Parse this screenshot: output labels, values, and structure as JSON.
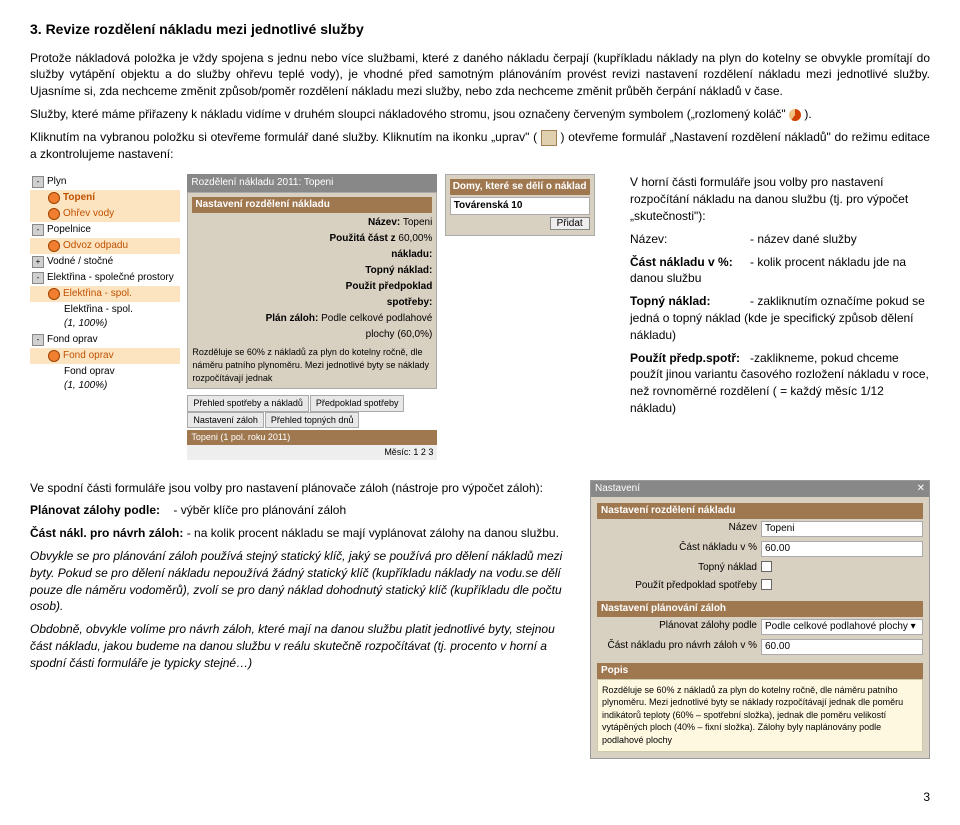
{
  "heading": "3. Revize rozdělení nákladu mezi jednotlivé služby",
  "para1": "Protože nákladová položka je vždy spojena s jednu nebo více službami, které z daného nákladu čerpají (kupříkladu náklady na plyn do kotelny se obvykle promítají do služby vytápění objektu a do služby ohřevu teplé vody), je vhodné před samotným plánováním provést revizi nastavení rozdělení nákladu mezi jednotlivé služby. Ujasníme si, zda nechceme změnit způsob/poměr rozdělení nákladu mezi služby, nebo zda nechceme změnit průběh čerpání nákladů v čase.",
  "para2a": "Služby, které máme přiřazeny k nákladu vidíme v druhém sloupci nákladového stromu, jsou označeny červeným symbolem („rozlomený koláč\" ",
  "para2b": " ).",
  "para3a": "Kliknutím na vybranou položku si otevřeme formulář dané služby. Kliknutím na ikonku „uprav\" ( ",
  "para3b": " ) otevřeme formulář „Nastavení rozdělení nákladů\" do režimu editace a zkontrolujeme nastavení:",
  "tree": {
    "items": [
      {
        "label": "Plyn",
        "type": "root"
      },
      {
        "label": "Topení",
        "type": "child",
        "orange": true
      },
      {
        "label": "Ohřev vody",
        "type": "child",
        "orange": true
      },
      {
        "label": "Popelnice",
        "type": "root"
      },
      {
        "label": "Odvoz odpadu",
        "type": "child",
        "orange": true
      },
      {
        "label": "Vodné / stočné",
        "type": "root"
      },
      {
        "label": "Elektřina - společné prostory",
        "type": "root"
      },
      {
        "label": "Elektřina - spol.",
        "type": "child",
        "orange": true
      },
      {
        "label": "Elektřina - spol.",
        "type": "child2",
        "note": "(1, 100%)"
      },
      {
        "label": "Fond oprav",
        "type": "root"
      },
      {
        "label": "Fond oprav",
        "type": "child",
        "orange": true
      },
      {
        "label": "Fond oprav",
        "type": "child2",
        "note": "(1, 100%)"
      }
    ]
  },
  "form": {
    "topbar": "Rozdělení nákladu 2011: Topeni",
    "header": "Nastavení rozdělení nákladu",
    "rows": {
      "nazev_l": "Název:",
      "nazev_v": "Topeni",
      "cast_l": "Použitá část z",
      "cast_v": "60,00%",
      "naklad_l": "nákladu:",
      "topny_l": "Topný náklad:",
      "predp_l": "Použit předpoklad",
      "spotr_l": "spotřeby:",
      "plan_l": "Plán záloh:",
      "plan_v": "Podle celkové podlahové",
      "plan_v2": "plochy (60,0%)"
    },
    "note": "Rozděluje se 60% z nákladů za plyn do kotelny ročně, dle náměru patního plynoměru. Mezi jednotlivé byty se náklady rozpočítávají jednak",
    "tabs": [
      "Přehled spotřeby a nákladů",
      "Předpoklad spotřeby",
      "Nastavení záloh",
      "Přehled topných dnů"
    ],
    "footer_l": "Topeni (1 pol. roku 2011)",
    "footer_r": "Měsíc:    1    2    3"
  },
  "house": {
    "header": "Domy, které se dělí o náklad",
    "item": "Továrenská 10",
    "btn": "Přidat"
  },
  "right1_intro": "V horní části formuláře jsou volby pro nastavení rozpočítání nákladu na danou službu (tj. pro výpočet „skutečnosti\"):",
  "right1": [
    {
      "k": "Název:",
      "v": "- název dané služby"
    },
    {
      "k": "Část nákladu v %:",
      "v": "- kolik procent nákladu jde na danou službu"
    },
    {
      "k": "Topný náklad:",
      "v": "- zakliknutím označíme pokud se jedná o topný náklad (kde je specifický způsob dělení nákladu)"
    },
    {
      "k": "Použít předp.spotř:",
      "v": "-zaklikneme, pokud chceme použít jinou variantu časového rozložení nákladu v roce, než rovnoměrné  rozdělení ( = každý měsíc 1/12 nákladu)"
    }
  ],
  "bottom_left": {
    "intro": "Ve spodní části formuláře jsou volby pro nastavení plánovače záloh (nástroje pro výpočet záloh):",
    "r1k": "Plánovat zálohy podle:",
    "r1v": "- výběr klíče pro plánování záloh",
    "r2k": "Část nákl. pro návrh záloh:",
    "r2v": "- na kolik procent nákladu se mají vyplánovat zálohy na danou službu.",
    "p1": "Obvykle se pro plánování záloh používá stejný statický klíč, jaký se používá pro dělení nákladů mezi byty. Pokud se pro dělení nákladu nepoužívá žádný statický klíč (kupříkladu náklady na vodu.se dělí pouze dle náměru vodoměrů), zvolí se pro daný náklad dohodnutý statický klíč (kupříkladu dle počtu osob).",
    "p2": "Obdobně, obvykle volíme pro návrh záloh, které mají na danou službu platit jednotlivé byty, stejnou část nákladu, jakou budeme na danou službu v reálu skutečně rozpočítávat (tj. procento v horní a spodní části formuláře je typicky stejné…)"
  },
  "settings": {
    "bar_l": "Nastavení",
    "bar_r": "✕",
    "h1": "Nastavení rozdělení nákladu",
    "rows1": [
      {
        "l": "Název",
        "v": "Topeni"
      },
      {
        "l": "Část nákladu v %",
        "v": "60.00"
      },
      {
        "l": "Topný náklad",
        "v": "chk"
      },
      {
        "l": "Použít předpoklad spotřeby",
        "v": "chk"
      }
    ],
    "h2": "Nastavení plánování záloh",
    "rows2": [
      {
        "l": "Plánovat zálohy podle",
        "v": "Podle celkové podlahové plochy ▾"
      },
      {
        "l": "Část nákladu pro návrh záloh v %",
        "v": "60.00"
      }
    ],
    "h3": "Popis",
    "desc": "Rozděluje se 60% z nákladů za plyn do kotelny ročně, dle náměru patního plynoměru. Mezi jednotlivé byty se náklady rozpočítávají jednak dle poměru indikátorů teploty (60% – spotřební složka), jednak dle poměru velikostí vytápěných ploch (40% – fixní složka). Zálohy byly naplánovány podle podlahové plochy"
  },
  "page": "3"
}
